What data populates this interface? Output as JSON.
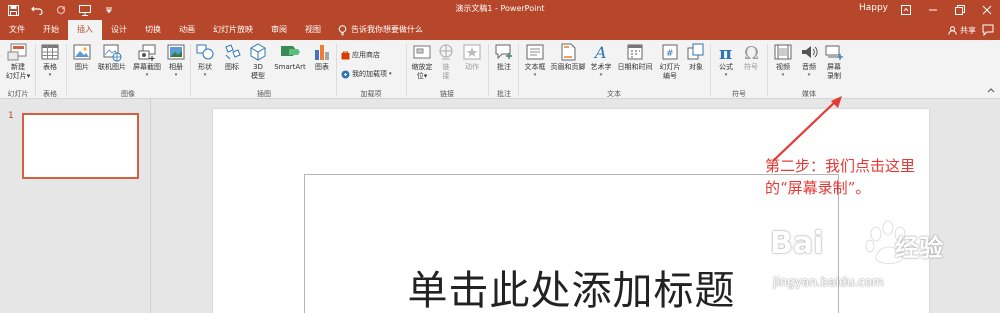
{
  "app": {
    "doc_title": "演示文稿1 - PowerPoint",
    "user": "Happy",
    "accent_color": "#b7472a"
  },
  "tabs": [
    {
      "label": "文件",
      "active": false
    },
    {
      "label": "开始",
      "active": false
    },
    {
      "label": "插入",
      "active": true
    },
    {
      "label": "设计",
      "active": false
    },
    {
      "label": "切换",
      "active": false
    },
    {
      "label": "动画",
      "active": false
    },
    {
      "label": "幻灯片放映",
      "active": false
    },
    {
      "label": "审阅",
      "active": false
    },
    {
      "label": "视图",
      "active": false
    }
  ],
  "tell_me": "告诉我你想要做什么",
  "share": "共享",
  "ribbon": {
    "new_slide": [
      "新建",
      "幻灯片"
    ],
    "table": "表格",
    "picture": "图片",
    "online_picture": "联机图片",
    "screenshot": "屏幕截图",
    "album": "相册",
    "shapes": "形状",
    "icons": "图标",
    "model3d": [
      "3D",
      "模型"
    ],
    "smartart": "SmartArt",
    "chart": "图表",
    "store": "应用商店",
    "my_addins": "我的加载项",
    "zoom": [
      "缩放定",
      "位"
    ],
    "link": [
      "链",
      "接"
    ],
    "action": "动作",
    "comment": "批注",
    "textbox": "文本框",
    "header_footer": "页眉和页脚",
    "wordart": "艺术字",
    "datetime": "日期和时间",
    "slide_number": [
      "幻灯片",
      "编号"
    ],
    "object": "对象",
    "equation": "公式",
    "symbol": "符号",
    "video": "视频",
    "audio": "音频",
    "screen_record": [
      "屏幕",
      "录制"
    ]
  },
  "groups": {
    "slides": "幻灯片",
    "tables": "表格",
    "images": "图像",
    "illustrations": "插图",
    "addins": "加载项",
    "links": "链接",
    "comments": "批注",
    "text": "文本",
    "symbols": "符号",
    "media": "媒体"
  },
  "slide_pane": {
    "slide_number": "1"
  },
  "slide": {
    "title_placeholder": "单击此处添加标题"
  },
  "annotation": {
    "line1": "第二步：我们点击这里",
    "line2": "的“屏幕录制”。",
    "color": "#e53935"
  },
  "watermark": {
    "brand": "Bai",
    "brand_cn": "经验",
    "url": "jingyan.baidu.com"
  }
}
